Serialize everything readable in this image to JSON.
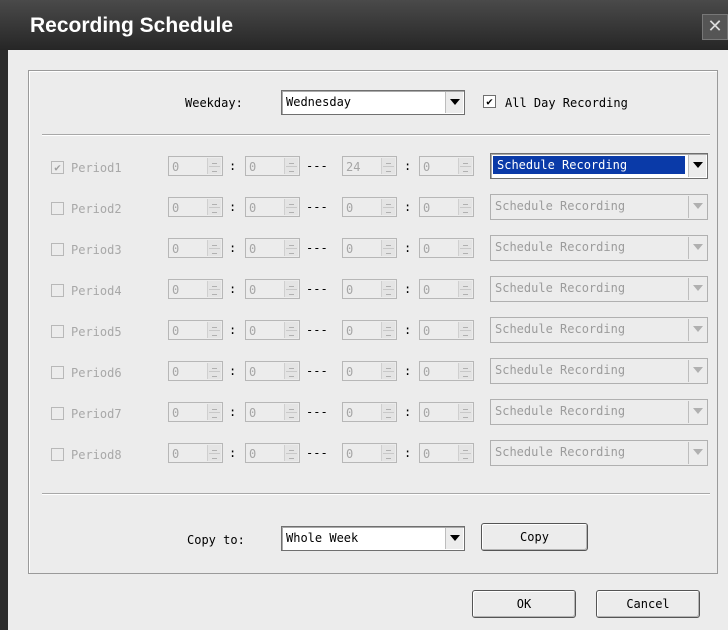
{
  "window": {
    "title": "Recording Schedule",
    "close_glyph": "✕"
  },
  "weekday": {
    "label": "Weekday:",
    "value": "Wednesday",
    "all_day_label": "All Day Recording",
    "all_day_checked": true
  },
  "periods": [
    {
      "label": "Period1",
      "checked": true,
      "start_h": "0",
      "start_m": "0",
      "end_h": "24",
      "end_m": "0",
      "mode": "Schedule Recording",
      "enabled": true
    },
    {
      "label": "Period2",
      "checked": false,
      "start_h": "0",
      "start_m": "0",
      "end_h": "0",
      "end_m": "0",
      "mode": "Schedule Recording",
      "enabled": false
    },
    {
      "label": "Period3",
      "checked": false,
      "start_h": "0",
      "start_m": "0",
      "end_h": "0",
      "end_m": "0",
      "mode": "Schedule Recording",
      "enabled": false
    },
    {
      "label": "Period4",
      "checked": false,
      "start_h": "0",
      "start_m": "0",
      "end_h": "0",
      "end_m": "0",
      "mode": "Schedule Recording",
      "enabled": false
    },
    {
      "label": "Period5",
      "checked": false,
      "start_h": "0",
      "start_m": "0",
      "end_h": "0",
      "end_m": "0",
      "mode": "Schedule Recording",
      "enabled": false
    },
    {
      "label": "Period6",
      "checked": false,
      "start_h": "0",
      "start_m": "0",
      "end_h": "0",
      "end_m": "0",
      "mode": "Schedule Recording",
      "enabled": false
    },
    {
      "label": "Period7",
      "checked": false,
      "start_h": "0",
      "start_m": "0",
      "end_h": "0",
      "end_m": "0",
      "mode": "Schedule Recording",
      "enabled": false
    },
    {
      "label": "Period8",
      "checked": false,
      "start_h": "0",
      "start_m": "0",
      "end_h": "0",
      "end_m": "0",
      "mode": "Schedule Recording",
      "enabled": false
    }
  ],
  "separators": {
    "colon": ":",
    "dash": "---"
  },
  "copy": {
    "label": "Copy to:",
    "value": "Whole Week",
    "button": "Copy"
  },
  "footer": {
    "ok": "OK",
    "cancel": "Cancel"
  }
}
